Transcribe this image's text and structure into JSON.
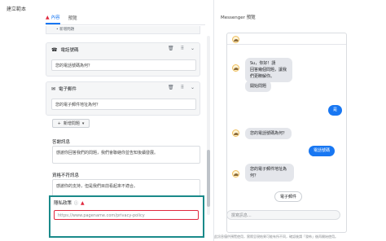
{
  "dialog": {
    "title": "建立範本",
    "close_icon": "close-icon"
  },
  "tabs": [
    {
      "label": "內容",
      "active": true,
      "warning": true
    },
    {
      "label": "預覽",
      "active": false,
      "warning": false
    }
  ],
  "questions": {
    "partial_item": "• 新增問題",
    "items": [
      {
        "type_label": "電話號碼",
        "icon": "phone-icon",
        "value": "您的電話號碼為何？"
      },
      {
        "type_label": "電子郵件",
        "icon": "email-icon",
        "value": "您的電子郵件地址為何？"
      }
    ],
    "add_button_label": "新增問題"
  },
  "greeting": {
    "label": "答謝訊息",
    "value": "感謝你回答我們的問題，我們會聯絡你並告知後續發展。"
  },
  "disqualified": {
    "label": "資格不符訊息",
    "value": "感謝你的支持，但是我們目前看起來不適合。"
  },
  "privacy": {
    "label": "隱私政策",
    "placeholder": "https://www.pagename.com/privacy-policy"
  },
  "preview": {
    "title": "Messenger 預覽",
    "messages": [
      {
        "from": "bot",
        "text": "Su，你好！請\n回答幾個問題，讓我\n們更瞭解你。"
      },
      {
        "from": "bot",
        "text": "開始問題"
      },
      {
        "from": "user",
        "text": "是"
      },
      {
        "from": "bot",
        "text": "您的電話號碼為何？"
      },
      {
        "from": "user",
        "text": "電話號碼"
      },
      {
        "from": "bot",
        "text": "您的電子郵件地址為\n何？"
      },
      {
        "from": "reply",
        "text": "電子郵件"
      }
    ],
    "composer_placeholder": "撰寫訊息...",
    "footnote": "此訊息僅供預覽使用，實際呈現結果可能有所不同，確認後請「發佈」後再開始使用。"
  },
  "colors": {
    "accent": "#1877f2",
    "warning": "#e0283e",
    "highlight": "#1a8a8a"
  }
}
